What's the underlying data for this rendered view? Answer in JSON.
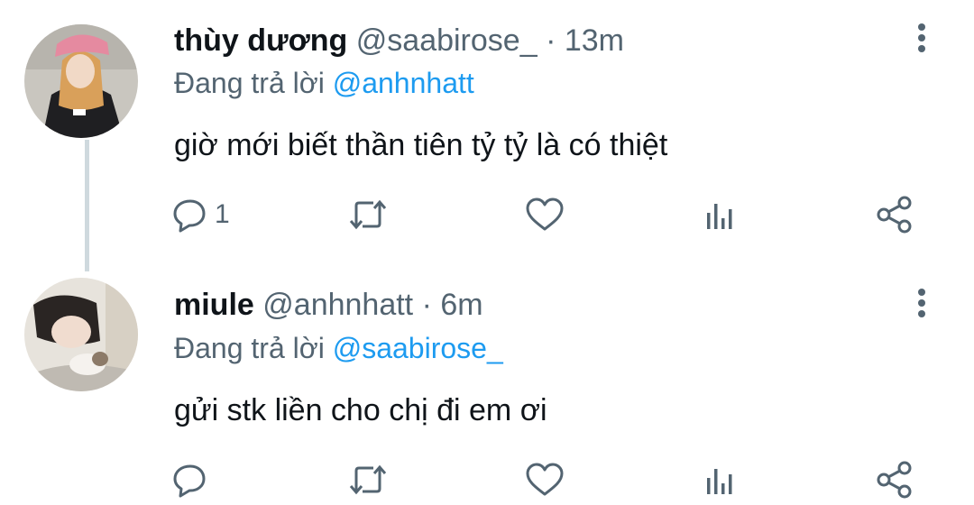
{
  "tweets": [
    {
      "name": "thùy dương",
      "handle": "@saabirose_",
      "time": "13m",
      "reply_prefix": "Đang trả lời",
      "reply_to": "@anhnhatt",
      "text": "giờ mới biết thần tiên tỷ tỷ là có thiệt",
      "reply_count": "1"
    },
    {
      "name": "miule",
      "handle": "@anhnhatt",
      "time": "6m",
      "reply_prefix": "Đang trả lời",
      "reply_to": "@saabirose_",
      "text": "gửi stk liền cho chị đi em ơi",
      "reply_count": ""
    }
  ],
  "icons": {
    "reply": "speech-bubble-icon",
    "retweet": "retweet-icon",
    "like": "heart-icon",
    "views": "bar-chart-icon",
    "share": "share-icon",
    "more": "vertical-ellipsis-icon"
  },
  "colors": {
    "text": "#0f1419",
    "secondary": "#536471",
    "mention": "#1d9bf0",
    "thread_line": "#cfd9de"
  }
}
